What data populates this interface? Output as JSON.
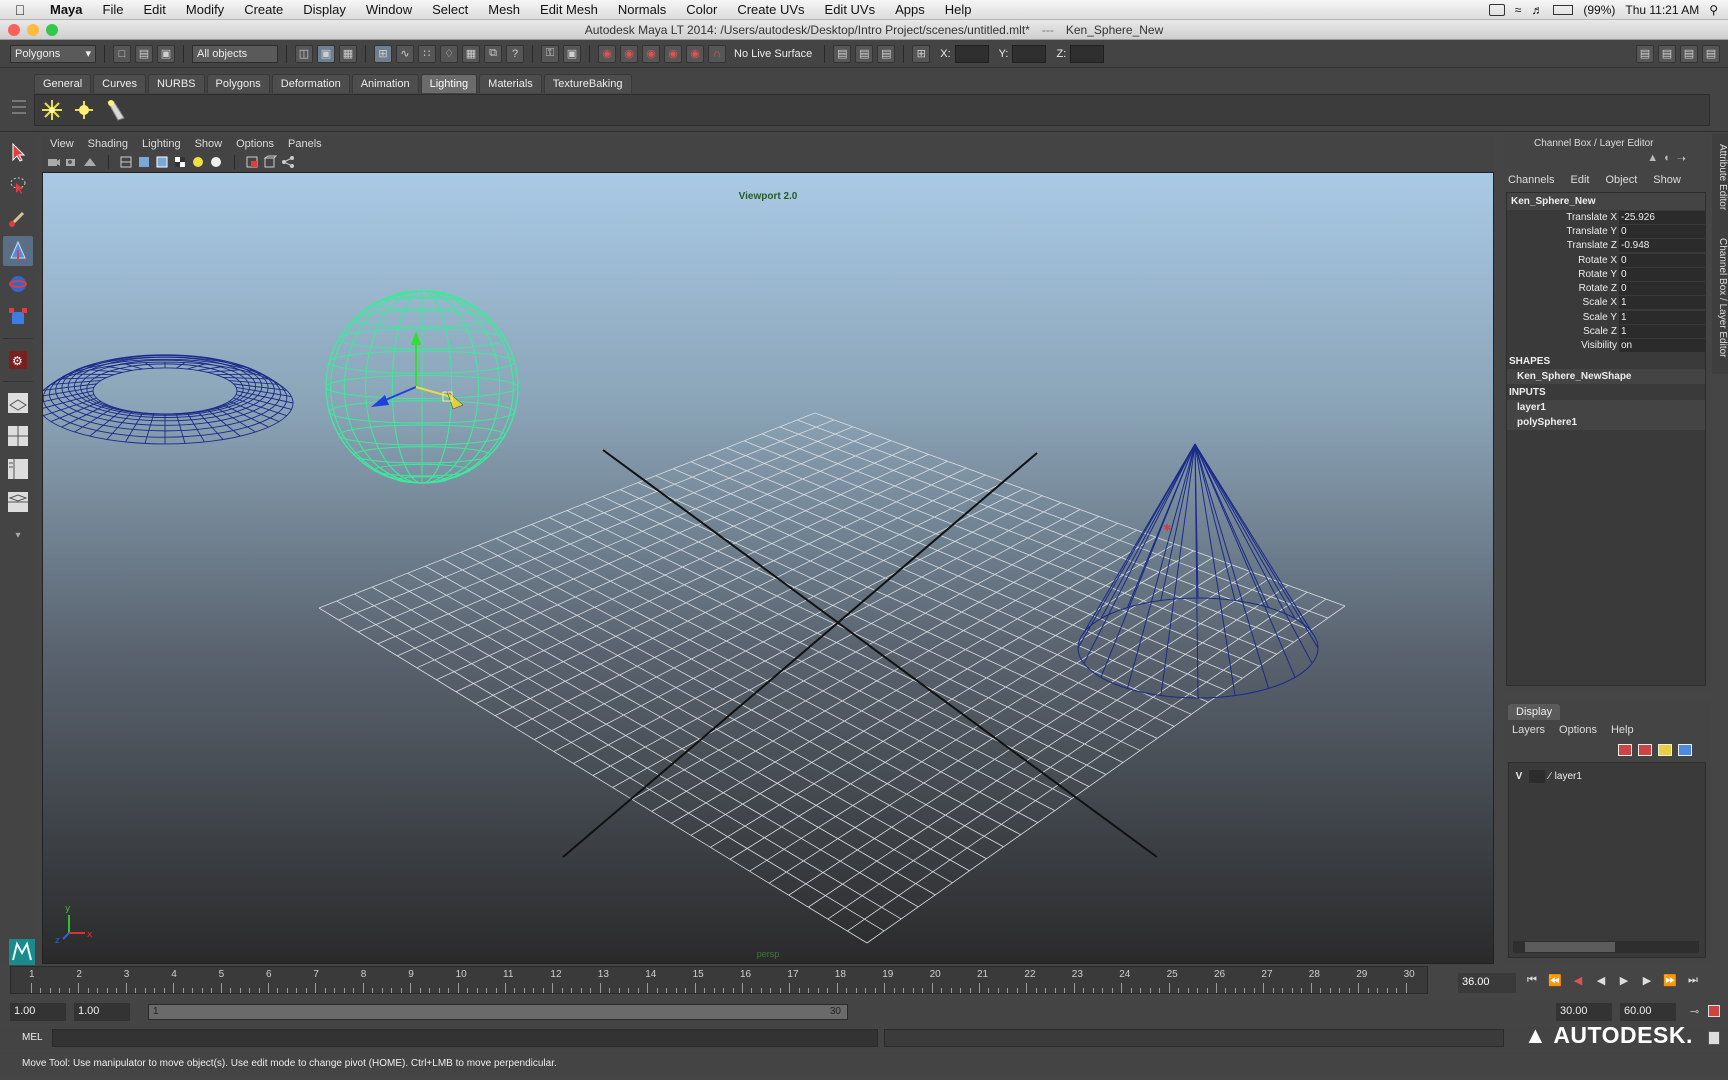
{
  "mac_menubar": {
    "app": "Maya",
    "items": [
      "File",
      "Edit",
      "Modify",
      "Create",
      "Display",
      "Window",
      "Select",
      "Mesh",
      "Edit Mesh",
      "Normals",
      "Color",
      "Create UVs",
      "Edit UVs",
      "Apps",
      "Help"
    ],
    "battery": "(99%)",
    "clock": "Thu 11:21 AM"
  },
  "window": {
    "title": "Autodesk Maya LT 2014: /Users/autodesk/Desktop/Intro Project/scenes/untitled.mlt*",
    "separator": "---",
    "object": "Ken_Sphere_New"
  },
  "status_line": {
    "menu_set": "Polygons",
    "selection_mask": "All objects",
    "live_surface": "No Live Surface",
    "x_label": "X:",
    "y_label": "Y:",
    "z_label": "Z:"
  },
  "shelf": {
    "tabs": [
      "General",
      "Curves",
      "NURBS",
      "Polygons",
      "Deformation",
      "Animation",
      "Lighting",
      "Materials",
      "TextureBaking"
    ],
    "active_tab": "Lighting"
  },
  "viewport": {
    "menu": [
      "View",
      "Shading",
      "Lighting",
      "Show",
      "Options",
      "Panels"
    ],
    "renderer_label": "Viewport 2.0",
    "camera": "persp",
    "grid_color": "#d8dde2",
    "sphere_color": "#3fe89a",
    "wire_color": "#1b2a8a"
  },
  "channel_box": {
    "header": "Channel Box / Layer Editor",
    "menu": [
      "Channels",
      "Edit",
      "Object",
      "Show"
    ],
    "object_name": "Ken_Sphere_New",
    "attributes": [
      {
        "name": "Translate X",
        "value": "-25.926"
      },
      {
        "name": "Translate Y",
        "value": "0"
      },
      {
        "name": "Translate Z",
        "value": "-0.948"
      },
      {
        "name": "Rotate X",
        "value": "0"
      },
      {
        "name": "Rotate Y",
        "value": "0"
      },
      {
        "name": "Rotate Z",
        "value": "0"
      },
      {
        "name": "Scale X",
        "value": "1"
      },
      {
        "name": "Scale Y",
        "value": "1"
      },
      {
        "name": "Scale Z",
        "value": "1"
      },
      {
        "name": "Visibility",
        "value": "on"
      }
    ],
    "shapes_label": "SHAPES",
    "shape": "Ken_Sphere_NewShape",
    "inputs_label": "INPUTS",
    "inputs": [
      "layer1",
      "polySphere1"
    ]
  },
  "side_tabs": {
    "attribute_editor": "Attribute Editor",
    "channel_box": "Channel Box / Layer Editor"
  },
  "layer_editor": {
    "tab": "Display",
    "menu": [
      "Layers",
      "Options",
      "Help"
    ],
    "layers": [
      {
        "visible": "V",
        "name": "layer1"
      }
    ]
  },
  "time_slider": {
    "ticks": [
      "1",
      "2",
      "3",
      "4",
      "5",
      "6",
      "7",
      "8",
      "9",
      "10",
      "11",
      "12",
      "13",
      "14",
      "15",
      "16",
      "17",
      "18",
      "19",
      "20",
      "21",
      "22",
      "23",
      "24",
      "25",
      "26",
      "27",
      "28",
      "29",
      "30"
    ],
    "current_time": "36.00"
  },
  "range_slider": {
    "start_time": "1.00",
    "range_start": "1.00",
    "inner_start": "1",
    "inner_end": "30",
    "range_end": "30.00",
    "end_time": "60.00"
  },
  "command_line": {
    "label": "MEL"
  },
  "brand": "AUTODESK.",
  "help_line": "Move Tool: Use manipulator to move object(s). Use edit mode to change pivot (HOME).  Ctrl+LMB to move perpendicular."
}
